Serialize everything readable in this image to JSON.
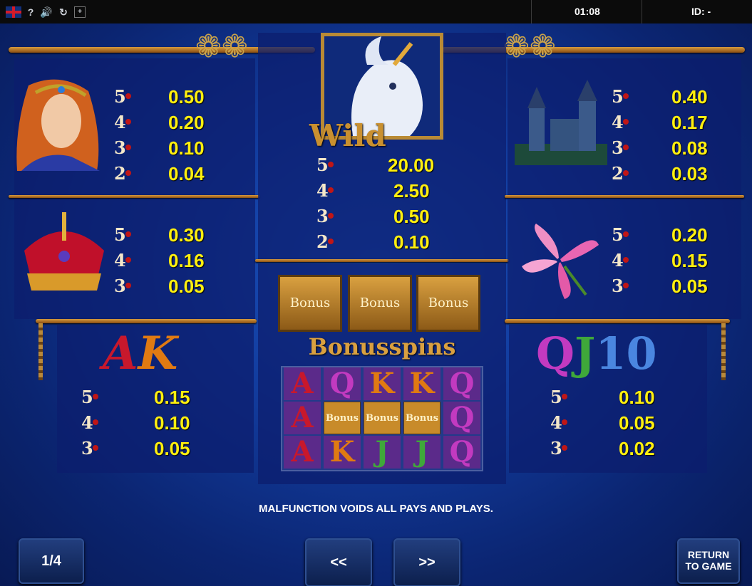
{
  "topbar": {
    "help": "?",
    "time": "01:08",
    "id": "ID: -"
  },
  "wild": {
    "label": "Wild",
    "pays": [
      {
        "count": "5",
        "value": "20.00"
      },
      {
        "count": "4",
        "value": "2.50"
      },
      {
        "count": "3",
        "value": "0.50"
      },
      {
        "count": "2",
        "value": "0.10"
      }
    ]
  },
  "maiden": {
    "pays": [
      {
        "count": "5",
        "value": "0.50"
      },
      {
        "count": "4",
        "value": "0.20"
      },
      {
        "count": "3",
        "value": "0.10"
      },
      {
        "count": "2",
        "value": "0.04"
      }
    ]
  },
  "castle": {
    "pays": [
      {
        "count": "5",
        "value": "0.40"
      },
      {
        "count": "4",
        "value": "0.17"
      },
      {
        "count": "3",
        "value": "0.08"
      },
      {
        "count": "2",
        "value": "0.03"
      }
    ]
  },
  "crown": {
    "pays": [
      {
        "count": "5",
        "value": "0.30"
      },
      {
        "count": "4",
        "value": "0.16"
      },
      {
        "count": "3",
        "value": "0.05"
      }
    ]
  },
  "lily": {
    "pays": [
      {
        "count": "5",
        "value": "0.20"
      },
      {
        "count": "4",
        "value": "0.15"
      },
      {
        "count": "3",
        "value": "0.05"
      }
    ]
  },
  "ak": {
    "label": "AK",
    "pays": [
      {
        "count": "5",
        "value": "0.15"
      },
      {
        "count": "4",
        "value": "0.10"
      },
      {
        "count": "3",
        "value": "0.05"
      }
    ]
  },
  "qj10": {
    "label_q": "Q",
    "label_j": "J",
    "label_10": "10",
    "pays": [
      {
        "count": "5",
        "value": "0.10"
      },
      {
        "count": "4",
        "value": "0.05"
      },
      {
        "count": "3",
        "value": "0.02"
      }
    ]
  },
  "bonus": {
    "tile_label": "Bonus",
    "title": "Bonusspins",
    "grid": [
      [
        "A",
        "Q",
        "K",
        "K",
        "Q"
      ],
      [
        "A",
        "Bonus",
        "Bonus",
        "Bonus",
        "Q"
      ],
      [
        "A",
        "K",
        "J",
        "J",
        "Q"
      ]
    ]
  },
  "colors": {
    "value": "#ffef0f",
    "A": "#c8182c",
    "K": "#e07a12",
    "Q": "#c23ac0",
    "J": "#3fa83a",
    "tile": "#c88b2a"
  },
  "footer": {
    "notice": "MALFUNCTION VOIDS ALL PAYS AND PLAYS.",
    "page": "1/4",
    "prev": "<<",
    "next": ">>",
    "return_line1": "RETURN",
    "return_line2": "TO GAME"
  }
}
